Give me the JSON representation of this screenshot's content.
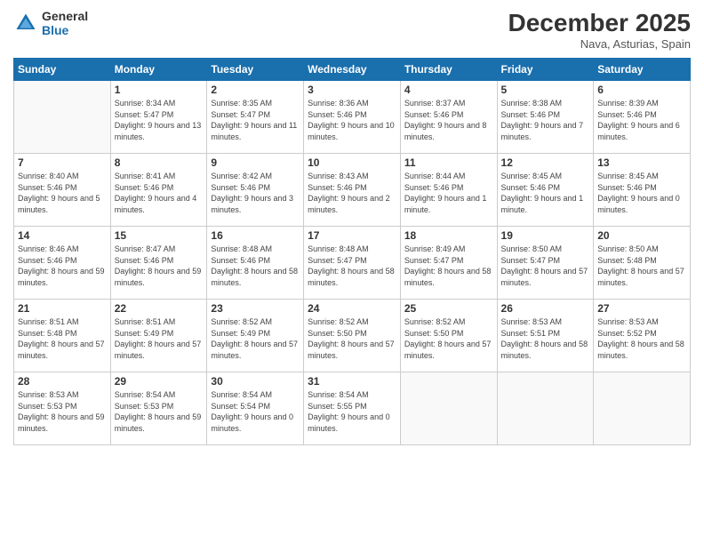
{
  "header": {
    "logo_line1": "General",
    "logo_line2": "Blue",
    "title": "December 2025",
    "subtitle": "Nava, Asturias, Spain"
  },
  "weekdays": [
    "Sunday",
    "Monday",
    "Tuesday",
    "Wednesday",
    "Thursday",
    "Friday",
    "Saturday"
  ],
  "weeks": [
    [
      {
        "day": "",
        "empty": true
      },
      {
        "day": "1",
        "sunrise": "Sunrise: 8:34 AM",
        "sunset": "Sunset: 5:47 PM",
        "daylight": "Daylight: 9 hours and 13 minutes."
      },
      {
        "day": "2",
        "sunrise": "Sunrise: 8:35 AM",
        "sunset": "Sunset: 5:47 PM",
        "daylight": "Daylight: 9 hours and 11 minutes."
      },
      {
        "day": "3",
        "sunrise": "Sunrise: 8:36 AM",
        "sunset": "Sunset: 5:46 PM",
        "daylight": "Daylight: 9 hours and 10 minutes."
      },
      {
        "day": "4",
        "sunrise": "Sunrise: 8:37 AM",
        "sunset": "Sunset: 5:46 PM",
        "daylight": "Daylight: 9 hours and 8 minutes."
      },
      {
        "day": "5",
        "sunrise": "Sunrise: 8:38 AM",
        "sunset": "Sunset: 5:46 PM",
        "daylight": "Daylight: 9 hours and 7 minutes."
      },
      {
        "day": "6",
        "sunrise": "Sunrise: 8:39 AM",
        "sunset": "Sunset: 5:46 PM",
        "daylight": "Daylight: 9 hours and 6 minutes."
      }
    ],
    [
      {
        "day": "7",
        "sunrise": "Sunrise: 8:40 AM",
        "sunset": "Sunset: 5:46 PM",
        "daylight": "Daylight: 9 hours and 5 minutes."
      },
      {
        "day": "8",
        "sunrise": "Sunrise: 8:41 AM",
        "sunset": "Sunset: 5:46 PM",
        "daylight": "Daylight: 9 hours and 4 minutes."
      },
      {
        "day": "9",
        "sunrise": "Sunrise: 8:42 AM",
        "sunset": "Sunset: 5:46 PM",
        "daylight": "Daylight: 9 hours and 3 minutes."
      },
      {
        "day": "10",
        "sunrise": "Sunrise: 8:43 AM",
        "sunset": "Sunset: 5:46 PM",
        "daylight": "Daylight: 9 hours and 2 minutes."
      },
      {
        "day": "11",
        "sunrise": "Sunrise: 8:44 AM",
        "sunset": "Sunset: 5:46 PM",
        "daylight": "Daylight: 9 hours and 1 minute."
      },
      {
        "day": "12",
        "sunrise": "Sunrise: 8:45 AM",
        "sunset": "Sunset: 5:46 PM",
        "daylight": "Daylight: 9 hours and 1 minute."
      },
      {
        "day": "13",
        "sunrise": "Sunrise: 8:45 AM",
        "sunset": "Sunset: 5:46 PM",
        "daylight": "Daylight: 9 hours and 0 minutes."
      }
    ],
    [
      {
        "day": "14",
        "sunrise": "Sunrise: 8:46 AM",
        "sunset": "Sunset: 5:46 PM",
        "daylight": "Daylight: 8 hours and 59 minutes."
      },
      {
        "day": "15",
        "sunrise": "Sunrise: 8:47 AM",
        "sunset": "Sunset: 5:46 PM",
        "daylight": "Daylight: 8 hours and 59 minutes."
      },
      {
        "day": "16",
        "sunrise": "Sunrise: 8:48 AM",
        "sunset": "Sunset: 5:46 PM",
        "daylight": "Daylight: 8 hours and 58 minutes."
      },
      {
        "day": "17",
        "sunrise": "Sunrise: 8:48 AM",
        "sunset": "Sunset: 5:47 PM",
        "daylight": "Daylight: 8 hours and 58 minutes."
      },
      {
        "day": "18",
        "sunrise": "Sunrise: 8:49 AM",
        "sunset": "Sunset: 5:47 PM",
        "daylight": "Daylight: 8 hours and 58 minutes."
      },
      {
        "day": "19",
        "sunrise": "Sunrise: 8:50 AM",
        "sunset": "Sunset: 5:47 PM",
        "daylight": "Daylight: 8 hours and 57 minutes."
      },
      {
        "day": "20",
        "sunrise": "Sunrise: 8:50 AM",
        "sunset": "Sunset: 5:48 PM",
        "daylight": "Daylight: 8 hours and 57 minutes."
      }
    ],
    [
      {
        "day": "21",
        "sunrise": "Sunrise: 8:51 AM",
        "sunset": "Sunset: 5:48 PM",
        "daylight": "Daylight: 8 hours and 57 minutes."
      },
      {
        "day": "22",
        "sunrise": "Sunrise: 8:51 AM",
        "sunset": "Sunset: 5:49 PM",
        "daylight": "Daylight: 8 hours and 57 minutes."
      },
      {
        "day": "23",
        "sunrise": "Sunrise: 8:52 AM",
        "sunset": "Sunset: 5:49 PM",
        "daylight": "Daylight: 8 hours and 57 minutes."
      },
      {
        "day": "24",
        "sunrise": "Sunrise: 8:52 AM",
        "sunset": "Sunset: 5:50 PM",
        "daylight": "Daylight: 8 hours and 57 minutes."
      },
      {
        "day": "25",
        "sunrise": "Sunrise: 8:52 AM",
        "sunset": "Sunset: 5:50 PM",
        "daylight": "Daylight: 8 hours and 57 minutes."
      },
      {
        "day": "26",
        "sunrise": "Sunrise: 8:53 AM",
        "sunset": "Sunset: 5:51 PM",
        "daylight": "Daylight: 8 hours and 58 minutes."
      },
      {
        "day": "27",
        "sunrise": "Sunrise: 8:53 AM",
        "sunset": "Sunset: 5:52 PM",
        "daylight": "Daylight: 8 hours and 58 minutes."
      }
    ],
    [
      {
        "day": "28",
        "sunrise": "Sunrise: 8:53 AM",
        "sunset": "Sunset: 5:53 PM",
        "daylight": "Daylight: 8 hours and 59 minutes."
      },
      {
        "day": "29",
        "sunrise": "Sunrise: 8:54 AM",
        "sunset": "Sunset: 5:53 PM",
        "daylight": "Daylight: 8 hours and 59 minutes."
      },
      {
        "day": "30",
        "sunrise": "Sunrise: 8:54 AM",
        "sunset": "Sunset: 5:54 PM",
        "daylight": "Daylight: 9 hours and 0 minutes."
      },
      {
        "day": "31",
        "sunrise": "Sunrise: 8:54 AM",
        "sunset": "Sunset: 5:55 PM",
        "daylight": "Daylight: 9 hours and 0 minutes."
      },
      {
        "day": "",
        "empty": true
      },
      {
        "day": "",
        "empty": true
      },
      {
        "day": "",
        "empty": true
      }
    ]
  ]
}
